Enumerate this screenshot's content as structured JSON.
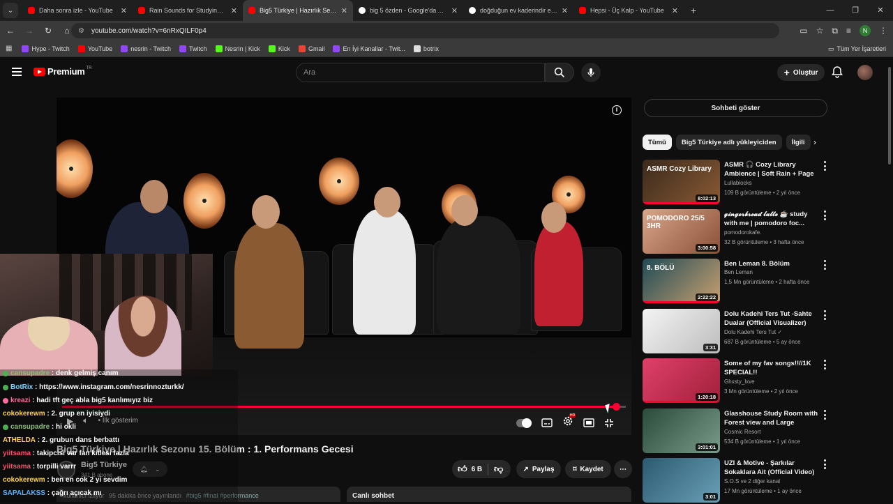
{
  "browser": {
    "tabs": [
      {
        "title": "Daha sonra izle - YouTube",
        "icon": "youtube-icon"
      },
      {
        "title": "Rain Sounds for Studying - Coz",
        "icon": "youtube-icon"
      },
      {
        "title": "Big5 Türkiye | Hazırlık Sezonu 1",
        "icon": "youtube-icon"
      },
      {
        "title": "big 5 özden - Google'da Ara",
        "icon": "google-icon"
      },
      {
        "title": "doğduğun ev kaderindir emine",
        "icon": "google-icon"
      },
      {
        "title": "Hepsi - Üç Kalp - YouTube",
        "icon": "youtube-icon"
      }
    ],
    "url": "youtube.com/watch?v=6nRxQILF0p4",
    "profile_initial": "N",
    "bookmarks": [
      {
        "label": "Hype - Twitch",
        "color": "#9146ff"
      },
      {
        "label": "YouTube",
        "color": "#ff0000"
      },
      {
        "label": "nesrin - Twitch",
        "color": "#9146ff"
      },
      {
        "label": "Twitch",
        "color": "#9146ff"
      },
      {
        "label": "Nesrin | Kick",
        "color": "#53fc18"
      },
      {
        "label": "Kick",
        "color": "#53fc18"
      },
      {
        "label": "Gmail",
        "color": "#ea4335"
      },
      {
        "label": "En İyi Kanallar - Twit...",
        "color": "#9146ff"
      },
      {
        "label": "botrix",
        "color": "#dddddd"
      }
    ],
    "all_bookmarks": "Tüm Yer İşaretleri"
  },
  "youtube": {
    "logo_text": "Premium",
    "logo_region": "TR",
    "search_placeholder": "Ara",
    "create_label": "Oluştur"
  },
  "player": {
    "progress_fraction": 0.983,
    "chapter_label": "İlk gösterim",
    "chat": [
      {
        "user": "cansupadre",
        "text": "denk gelmiş canım",
        "color": "#8ec07c",
        "badge": "#4caf50"
      },
      {
        "user": "BotRix",
        "text": "https://www.instagram.com/nesrinnozturkk/",
        "color": "#7bd3ff",
        "badge": "#4caf50"
      },
      {
        "user": "kreazi",
        "text": "hadi tft geç abla big5 kanlımıyız biz",
        "color": "#ff6b9a",
        "badge": "#ff6b9a"
      },
      {
        "user": "cokokerewm",
        "text": "2. grup en iyisiydi",
        "color": "#ffd24d",
        "badge": ""
      },
      {
        "user": "cansupadre",
        "text": "hi okli",
        "color": "#8ec07c",
        "badge": "#4caf50"
      },
      {
        "user": "ATHELDA",
        "text": "2. grubun dans berbattı",
        "color": "#ffd24d",
        "badge": ""
      },
      {
        "user": "yiitsama",
        "text": "takipcisi var fan kitlesi fazla",
        "color": "#ff4d6d",
        "badge": ""
      },
      {
        "user": "yiitsama",
        "text": "torpilli varrr",
        "color": "#ff4d6d",
        "badge": ""
      },
      {
        "user": "cokokerewm",
        "text": "ben en cok 2 yi sevdim",
        "color": "#ffd24d",
        "badge": ""
      },
      {
        "user": "SAPALAKSS",
        "text": "çağrı açıcak mı",
        "color": "#5ab0ff",
        "badge": ""
      }
    ]
  },
  "video": {
    "title": "Big5 Türkiye | Hazırlık Sezonu 15. Bölüm : 1. Performans Gecesi",
    "channel": "Big5 Türkiye",
    "subscribers": "341 B abone",
    "likes": "6 B",
    "share_label": "Paylaş",
    "save_label": "Kaydet",
    "description_meta": "95 dakika önce yayınlandı",
    "description_viewers": "kullanıcı izliyor",
    "description_tags": "#big5 #final #performance",
    "live_chat_label": "Canlı sohbet"
  },
  "sidebar": {
    "show_chat": "Sohbeti göster",
    "chips": [
      "Tümü",
      "Big5 Türkiye adlı yükleyiciden",
      "İlgili"
    ],
    "recommendations": [
      {
        "title": "ASMR 🎧 Cozy Library Ambience | Soft Rain + Page ...",
        "channel": "Lullablocks",
        "meta": "109 B görüntüleme • 2 yıl önce",
        "duration": "8:02:13",
        "watched": 1.0,
        "thumb_a": "#3a2a1c",
        "thumb_b": "#8a5a34",
        "thumb_text": "ASMR Cozy Library"
      },
      {
        "title": "𝓰𝓲𝓷𝓰𝓮𝓻𝓫𝓻𝓮𝓪𝓭 𝓵𝓪𝓽𝓽𝓮 ☕ study with me | pomodoro foc...",
        "channel": "pomodorokafe.",
        "meta": "32 B görüntüleme • 3 hafta önce",
        "duration": "3:00:58",
        "watched": 0,
        "thumb_a": "#d9a68a",
        "thumb_b": "#8a5038",
        "thumb_text": "POMODORO 25/5 3HR"
      },
      {
        "title": "Ben Leman 8. Bölüm",
        "channel": "Ben Leman",
        "meta": "1,5 Mn görüntüleme • 2 hafta önce",
        "duration": "2:22:22",
        "watched": 1.0,
        "thumb_a": "#1f4a55",
        "thumb_b": "#c8a070",
        "thumb_text": "8. BÖLÜ"
      },
      {
        "title": "Dolu Kadehi Ters Tut -Sahte Dualar (Official Visualizer)",
        "channel": "Dolu Kadehi Ters Tut ✓",
        "meta": "687 B görüntüleme • 5 ay önce",
        "duration": "3:31",
        "watched": 0,
        "thumb_a": "#f4f4f4",
        "thumb_b": "#bdbdbd",
        "thumb_text": ""
      },
      {
        "title": "Some of my fav songs!!//1K SPECIAL!!",
        "channel": "Ghxsty_lxve",
        "meta": "3 Mn görüntüleme • 2 yıl önce",
        "duration": "1:20:18",
        "watched": 1.0,
        "thumb_a": "#e0406a",
        "thumb_b": "#a0203a",
        "thumb_text": ""
      },
      {
        "title": "Glasshouse Study Room with Forest view and Large Window...",
        "channel": "Cosmic Resort",
        "meta": "534 B görüntüleme • 1 yıl önce",
        "duration": "3:01:01",
        "watched": 0,
        "thumb_a": "#2a4a3a",
        "thumb_b": "#7a9a8a",
        "thumb_text": ""
      },
      {
        "title": "UZI & Motive - Şarkılar Sokaklara Ait (Official Video)",
        "channel": "S.O.S ve 2 diğer kanal",
        "meta": "17 Mn görüntüleme • 1 ay önce",
        "duration": "3:01",
        "watched": 0,
        "thumb_a": "#2c5a70",
        "thumb_b": "#6aa0b8",
        "thumb_text": ""
      }
    ]
  }
}
